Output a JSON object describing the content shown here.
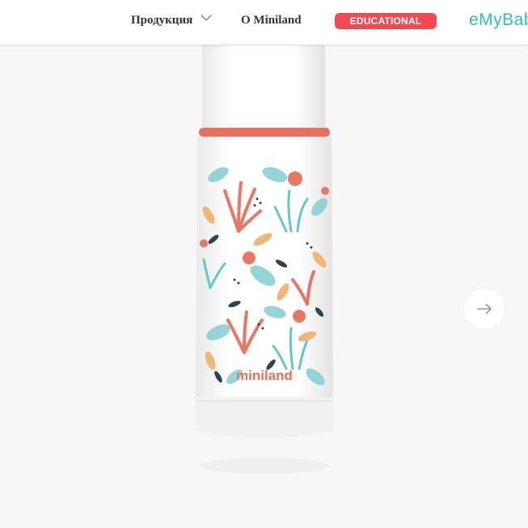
{
  "header": {
    "nav": [
      {
        "label": "Продукция"
      },
      {
        "label": "O Miniland"
      }
    ],
    "badge": {
      "label": "EDUCATIONAL",
      "color": "#f24a55"
    },
    "partner_logo": {
      "text": "eMyBab"
    }
  },
  "product": {
    "brand_print": "miniland",
    "colors": {
      "accent": "#e8705c",
      "teal": "#5cc4c8",
      "orange": "#f0a35a",
      "navy": "#1f3b44"
    }
  },
  "carousel": {
    "next_icon": "arrow-right-icon"
  }
}
